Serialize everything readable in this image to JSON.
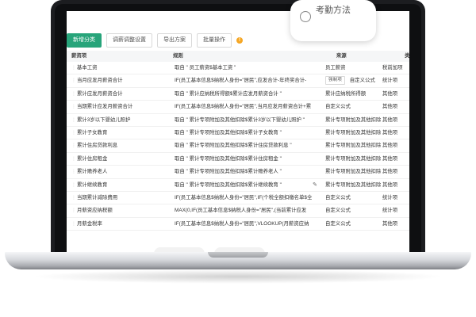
{
  "float_card": {
    "text": "考勤方法"
  },
  "toolbar": {
    "add_category": "新增分类",
    "adjust_settings": "调薪调整设置",
    "export_plan": "导出方案",
    "batch_ops": "批量操作",
    "warn": "!"
  },
  "table": {
    "headers": [
      "薪资项",
      "规则",
      "来源",
      "类"
    ],
    "rows": [
      {
        "name": "基本工资",
        "rule": "取自 \" 员工薪资$基本工资 \"",
        "tag": "",
        "source": "员工薪资",
        "type": "税前加项"
      },
      {
        "name": "当月应发月薪资合计",
        "rule": "IF(员工基本信息$纳税人身份=\"居民\",应发合计-年终奖合计-",
        "tag": "强制项",
        "source": "自定义公式",
        "type": "统计项"
      },
      {
        "name": "累计应发月薪资合计",
        "rule": "取自 \" 累计应纳税所得额$累计应发月薪资合计 \"",
        "tag": "",
        "source": "累计应纳税所得额",
        "type": "其他项"
      },
      {
        "name": "当期累计应发月薪资合计",
        "rule": "IF(员工基本信息$纳税人身份=\"居民\",当月应发月薪资合计+累",
        "tag": "",
        "source": "自定义公式",
        "type": "其他项"
      },
      {
        "name": "累计3岁以下婴幼儿照护",
        "rule": "取自 \" 累计专项附加及其他扣除$累计3岁以下婴幼儿照护 \"",
        "tag": "",
        "source": "累计专项附加及其他扣除",
        "type": "其他项"
      },
      {
        "name": "累计子女教育",
        "rule": "取自 \" 累计专项附加及其他扣除$累计子女教育 \"",
        "tag": "",
        "source": "累计专项附加及其他扣除",
        "type": "其他项"
      },
      {
        "name": "累计住房贷款利息",
        "rule": "取自 \" 累计专项附加及其他扣除$累计住房贷款利息 \"",
        "tag": "",
        "source": "累计专项附加及其他扣除",
        "type": "其他项"
      },
      {
        "name": "累计住房租金",
        "rule": "取自 \" 累计专项附加及其他扣除$累计住房租金 \"",
        "tag": "",
        "source": "累计专项附加及其他扣除",
        "type": "其他项"
      },
      {
        "name": "累计赡养老人",
        "rule": "取自 \" 累计专项附加及其他扣除$累计赡养老人 \"",
        "tag": "",
        "source": "累计专项附加及其他扣除",
        "type": "其他项"
      },
      {
        "name": "累计继续教育",
        "rule": "取自 \" 累计专项附加及其他扣除$累计继续教育 \"",
        "tag": "",
        "source": "累计专项附加及其他扣除",
        "type": "其他项"
      },
      {
        "name": "当期累计减除费用",
        "rule": "IF(员工基本信息$纳税人身份=\"居民\",IF(个税全额扣缴名单$全",
        "tag": "",
        "source": "自定义公式",
        "type": "统计项"
      },
      {
        "name": "月薪资应纳税额",
        "rule": "MAX(0,IF(员工基本信息$纳税人身份=\"居民\",(当前累计应发",
        "tag": "",
        "source": "自定义公式",
        "type": "统计项"
      },
      {
        "name": "月薪金税率",
        "rule": "IF(员工基本信息$纳税人身份=\"居民\",VLOOKUP(月薪资应纳",
        "tag": "",
        "source": "自定义公式",
        "type": "其他项"
      }
    ]
  }
}
